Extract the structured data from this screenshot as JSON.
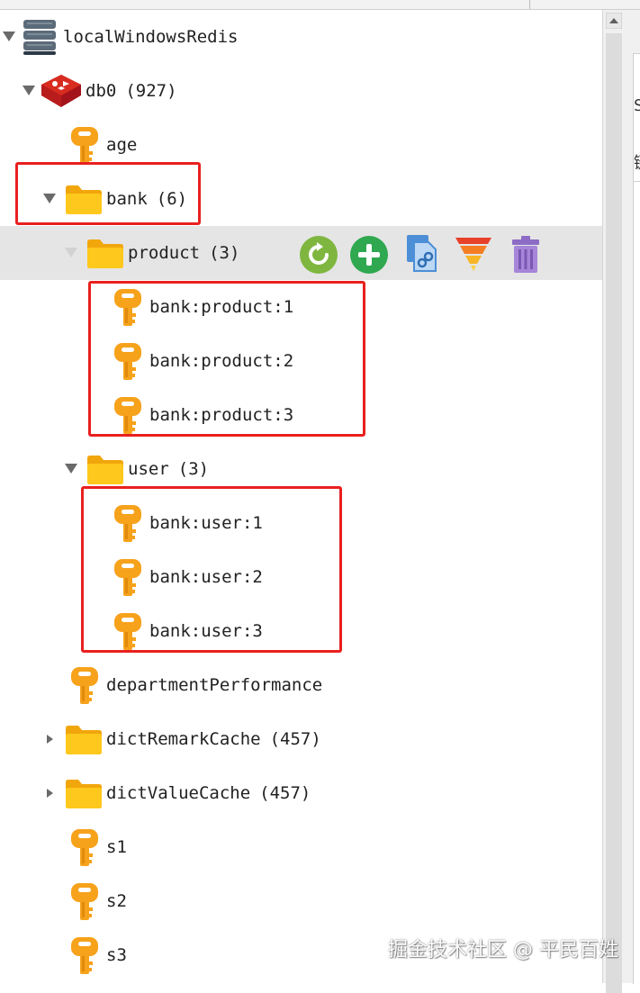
{
  "connection": {
    "name": "localWindowsRedis"
  },
  "database": {
    "name": "db0",
    "count": "(927)"
  },
  "keys": {
    "age": "age",
    "department": "departmentPerformance",
    "s1": "s1",
    "s2": "s2",
    "s3": "s3"
  },
  "folders": {
    "bank": {
      "name": "bank",
      "count": "(6)"
    },
    "product": {
      "name": "product",
      "count": "(3)",
      "keys": [
        "bank:product:1",
        "bank:product:2",
        "bank:product:3"
      ]
    },
    "user": {
      "name": "user",
      "count": "(3)",
      "keys": [
        "bank:user:1",
        "bank:user:2",
        "bank:user:3"
      ]
    },
    "dictRemark": {
      "name": "dictRemarkCache",
      "count": "(457)"
    },
    "dictValue": {
      "name": "dictValueCache",
      "count": "(457)"
    }
  },
  "toolbar": [
    "refresh-icon",
    "add-icon",
    "copy-link-icon",
    "filter-icon",
    "delete-icon"
  ],
  "right_pane": {
    "char_1": "S",
    "char_2": "键"
  },
  "watermark": "掘金技术社区 @ 平民百姓",
  "colors": {
    "highlight": "#e8201f",
    "selected_row": "#e5e5e5",
    "folder": "#ffc21a",
    "key": "#f7a21b"
  }
}
